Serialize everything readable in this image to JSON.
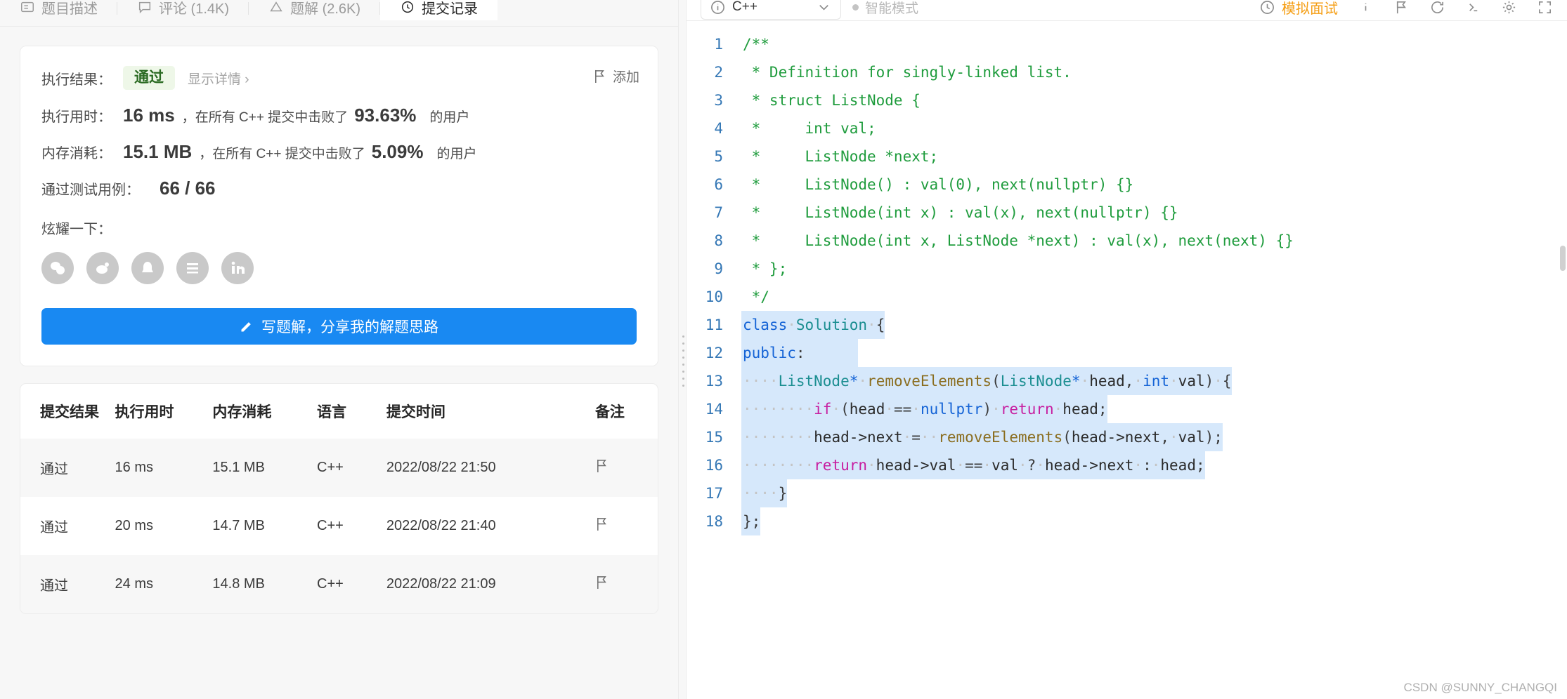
{
  "tabs": [
    {
      "label": "题目描述",
      "icon": "description-icon",
      "active": false
    },
    {
      "label": "评论 (1.4K)",
      "icon": "comment-icon",
      "active": false
    },
    {
      "label": "题解 (2.6K)",
      "icon": "solution-icon",
      "active": false
    },
    {
      "label": "提交记录",
      "icon": "clock-icon",
      "active": true
    }
  ],
  "result": {
    "result_label": "执行结果：",
    "status": "通过",
    "detail_link": "显示详情 ›",
    "add_note": "添加",
    "runtime_label": "执行用时：",
    "runtime_value": "16 ms",
    "runtime_prefix": "，在所有 C++ 提交中击败了",
    "runtime_pct": "93.63%",
    "runtime_suffix": "的用户",
    "memory_label": "内存消耗：",
    "memory_value": "15.1 MB",
    "memory_prefix": "，在所有 C++ 提交中击败了",
    "memory_pct": "5.09%",
    "memory_suffix": "的用户",
    "cases_label": "通过测试用例：",
    "cases_value": "66 / 66",
    "brag_label": "炫耀一下：",
    "socials": [
      "wechat-icon",
      "weibo-icon",
      "qq-icon",
      "douban-icon",
      "linkedin-icon"
    ],
    "write_button": "写题解，分享我的解题思路",
    "accent_blue": "#1989f2",
    "status_green": "#2a6a22"
  },
  "submissions": {
    "headers": [
      "提交结果",
      "执行用时",
      "内存消耗",
      "语言",
      "提交时间",
      "备注"
    ],
    "rows": [
      {
        "result": "通过",
        "time": "16 ms",
        "memory": "15.1 MB",
        "lang": "C++",
        "when": "2022/08/22 21:50",
        "note": "flag-icon"
      },
      {
        "result": "通过",
        "time": "20 ms",
        "memory": "14.7 MB",
        "lang": "C++",
        "when": "2022/08/22 21:40",
        "note": "flag-icon"
      },
      {
        "result": "通过",
        "time": "24 ms",
        "memory": "14.8 MB",
        "lang": "C++",
        "when": "2022/08/22 21:09",
        "note": "flag-icon"
      }
    ]
  },
  "editor": {
    "language": "C++",
    "smart_mode": "智能模式",
    "mock_interview": "模拟面试",
    "toolbar_icons": [
      "info-icon",
      "flag-icon",
      "refresh-icon",
      "format-icon",
      "settings-icon",
      "fullscreen-icon"
    ],
    "line_numbers": [
      1,
      2,
      3,
      4,
      5,
      6,
      7,
      8,
      9,
      10,
      11,
      12,
      13,
      14,
      15,
      16,
      17,
      18
    ],
    "lines": [
      "/**",
      " * Definition for singly-linked list.",
      " * struct ListNode {",
      " *     int val;",
      " *     ListNode *next;",
      " *     ListNode() : val(0), next(nullptr) {}",
      " *     ListNode(int x) : val(x), next(nullptr) {}",
      " *     ListNode(int x, ListNode *next) : val(x), next(next) {}",
      " * };",
      " */",
      "class Solution {",
      "public:",
      "    ListNode* removeElements(ListNode* head, int val) {",
      "        if (head == nullptr) return head;",
      "        head->next = removeElements(head->next, val);",
      "        return head->val == val ? head->next : head;",
      "    }",
      "};"
    ],
    "comment_color": "#1f9c3d",
    "keyword_color": "#1463d6",
    "type_color": "#1b8e91",
    "function_color": "#8a6d1f",
    "control_color": "#c71ea0",
    "linenum_color": "#3477b5",
    "selection_color": "#d6e8fb"
  },
  "watermark": "CSDN @SUNNY_CHANGQI"
}
